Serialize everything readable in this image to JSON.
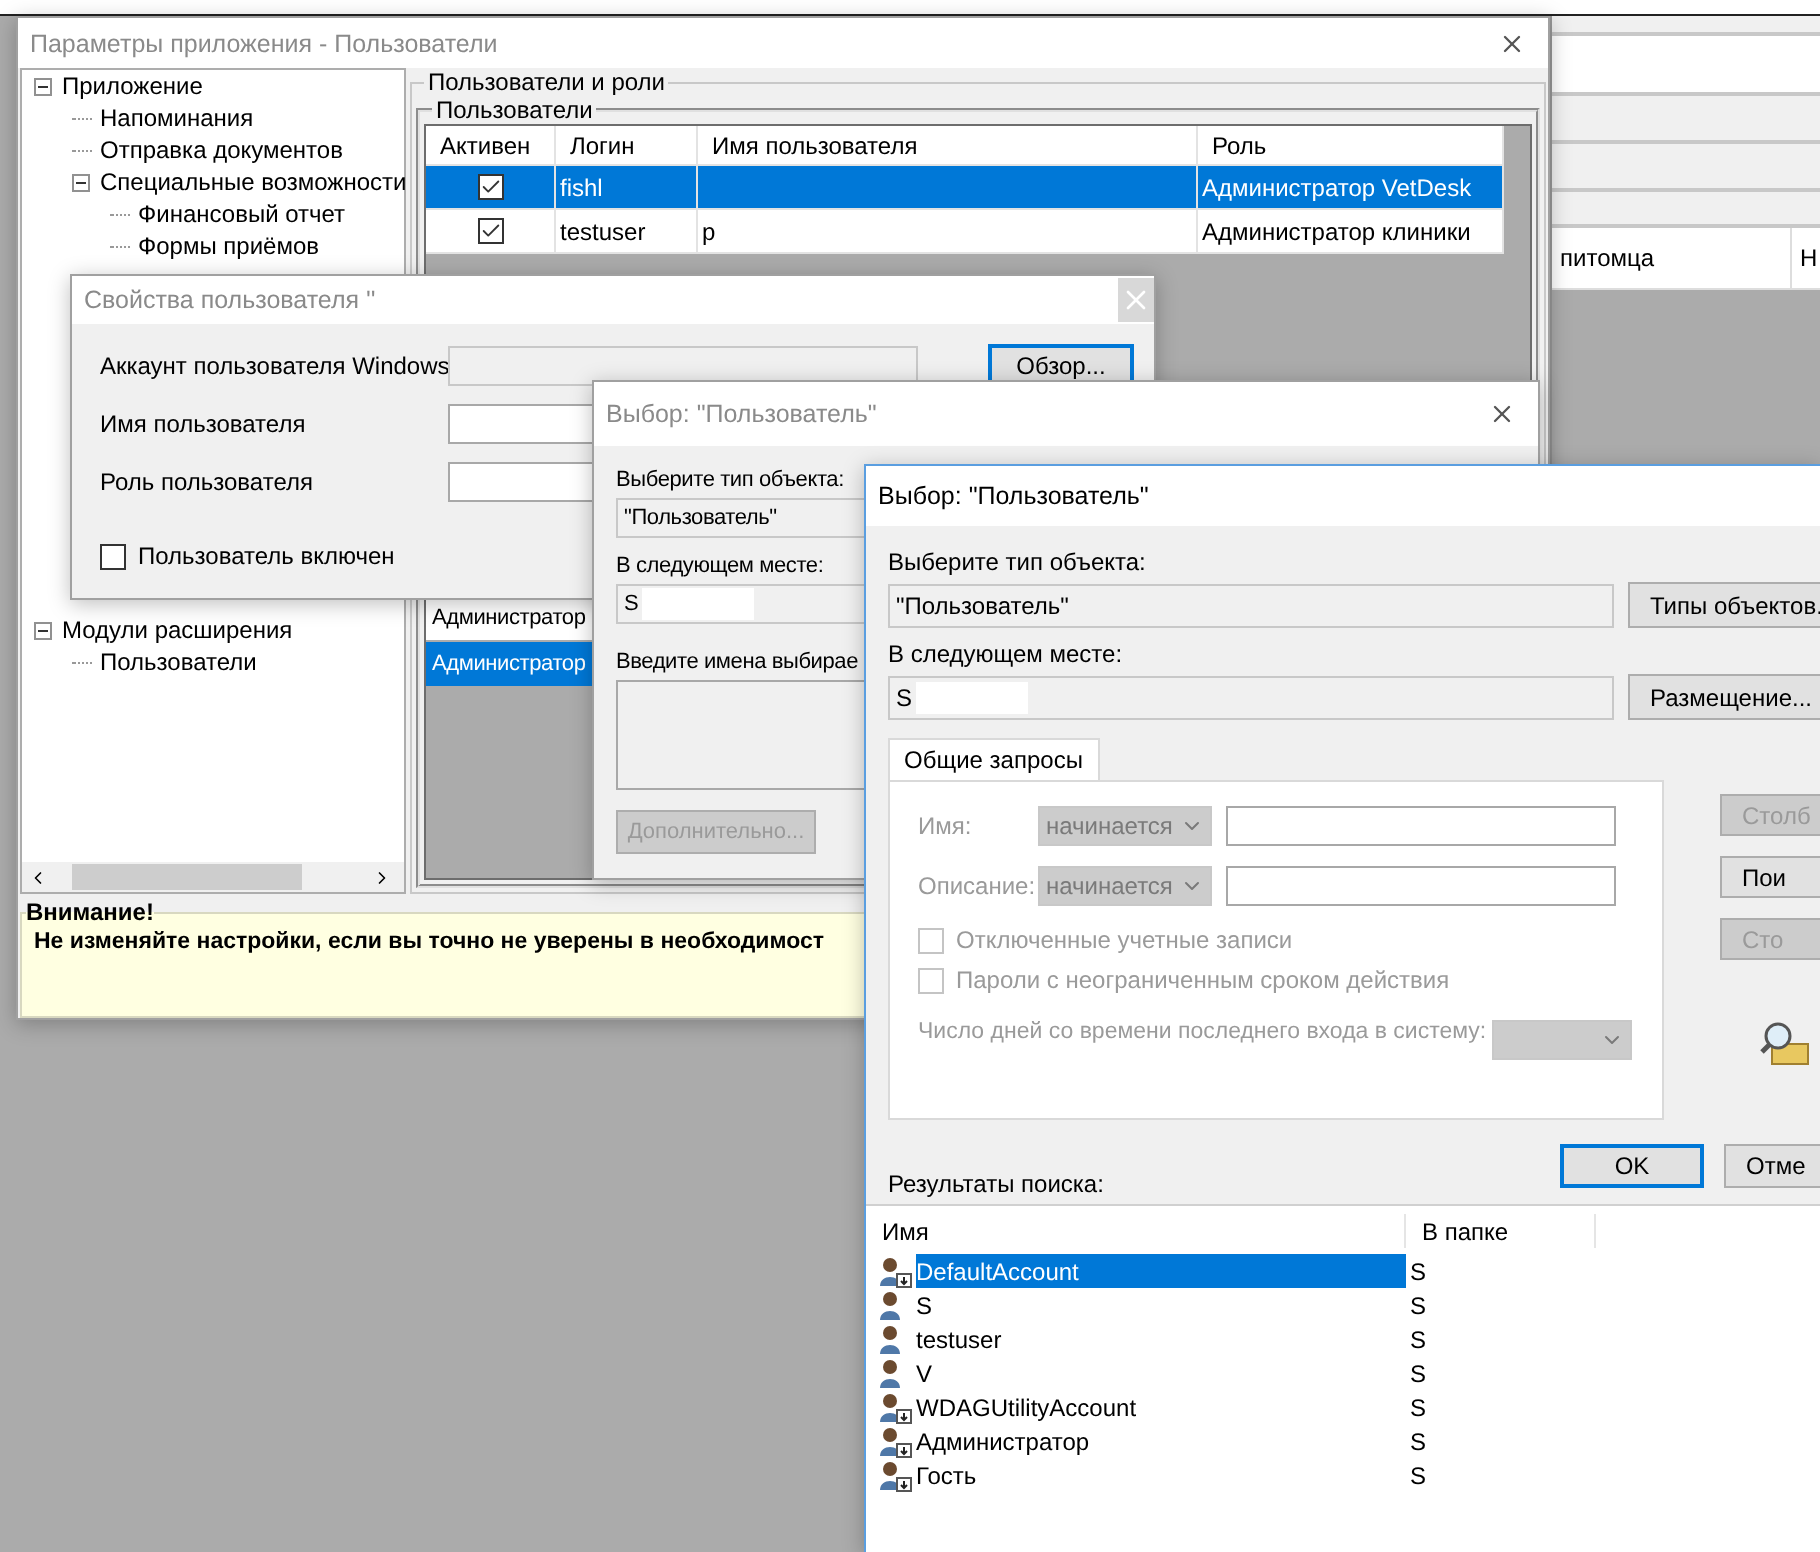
{
  "background_window": {
    "columns": [
      "питомца",
      "Н"
    ]
  },
  "main_window": {
    "title": "Параметры приложения - Пользователи",
    "tree": [
      {
        "label": "Приложение",
        "expanded": true,
        "children": [
          {
            "label": "Напоминания"
          },
          {
            "label": "Отправка документов"
          },
          {
            "label": "Специальные возможности",
            "expanded": true,
            "children": [
              {
                "label": "Финансовый отчет"
              },
              {
                "label": "Формы приёмов"
              }
            ]
          }
        ]
      },
      {
        "label": "Модули расширения",
        "expanded": true,
        "children": [
          {
            "label": "Пользователи"
          }
        ]
      }
    ],
    "group_title": "Пользователи и роли",
    "subgroup_title": "Пользователи",
    "users_table": {
      "columns": [
        "Активен",
        "Логин",
        "Имя пользователя",
        "Роль"
      ],
      "rows": [
        {
          "active": true,
          "login": "fishl",
          "role": "Администратор VetDesk",
          "selected": true
        },
        {
          "active": true,
          "login": "testuser",
          "name": "p",
          "role": "Администратор клиники",
          "selected": false
        }
      ]
    },
    "roles_list": [
      {
        "label": "Администратор",
        "selected": false
      },
      {
        "label": "Администратор",
        "selected": true
      }
    ],
    "warning": {
      "title": "Внимание!",
      "text": "Не изменяйте настройки, если вы точно не уверены в необходимост"
    }
  },
  "properties_dialog": {
    "title": "Свойства пользователя ''",
    "fields": [
      {
        "label": "Аккаунт пользователя Windows",
        "disabled": true
      },
      {
        "label": "Имя пользователя",
        "disabled": false
      },
      {
        "label": "Роль пользователя",
        "disabled": false
      }
    ],
    "browse_button": "Обзор...",
    "enabled_checkbox": {
      "label": "Пользователь включен",
      "checked": false
    }
  },
  "select_dialog_back": {
    "title": "Выбор: \"Пользователь\"",
    "object_type_label": "Выберите тип объекта:",
    "object_type": "\"Пользователь\"",
    "location_label": "В следующем месте:",
    "location": "S",
    "names_label": "Введите имена выбирае",
    "advanced_button": {
      "label": "Дополнительно...",
      "disabled": true
    }
  },
  "select_dialog": {
    "title": "Выбор: \"Пользователь\"",
    "object_type_label": "Выберите тип объекта:",
    "object_type": "\"Пользователь\"",
    "object_types_button": "Типы объектов.",
    "location_label": "В следующем месте:",
    "location": "S",
    "locations_button": "Размещение...",
    "tab": {
      "label": "Общие запросы",
      "selected": true
    },
    "query": {
      "disabled": true,
      "name_label": "Имя:",
      "name_op": "начинается",
      "description_label": "Описание:",
      "description_op": "начинается",
      "checkboxes": [
        {
          "label": "Отключенные учетные записи",
          "checked": false
        },
        {
          "label": "Пароли с неограниченным сроком действия",
          "checked": false
        }
      ],
      "days_label": "Число дней со времени последнего входа в систему:"
    },
    "side_buttons": [
      {
        "label": "Столб",
        "disabled": true
      },
      {
        "label": "Пои",
        "disabled": false
      },
      {
        "label": "Сто",
        "disabled": true
      }
    ],
    "ok_button": "OK",
    "cancel_button": "Отме",
    "results_label": "Результаты поиска:",
    "results": {
      "columns": [
        "Имя",
        "В папке"
      ],
      "rows": [
        {
          "name": "DefaultAccount",
          "folder": "S",
          "kind": "disabled",
          "selected": true
        },
        {
          "name": "S",
          "folder": "S",
          "kind": "active",
          "selected": false
        },
        {
          "name": "testuser",
          "folder": "S",
          "kind": "active",
          "selected": false
        },
        {
          "name": "V",
          "folder": "S",
          "kind": "active",
          "selected": false
        },
        {
          "name": "WDAGUtilityAccount",
          "folder": "S",
          "kind": "disabled",
          "selected": false
        },
        {
          "name": "Администратор",
          "folder": "S",
          "kind": "disabled",
          "selected": false
        },
        {
          "name": "Гость",
          "folder": "S",
          "kind": "disabled",
          "selected": false
        }
      ]
    }
  }
}
